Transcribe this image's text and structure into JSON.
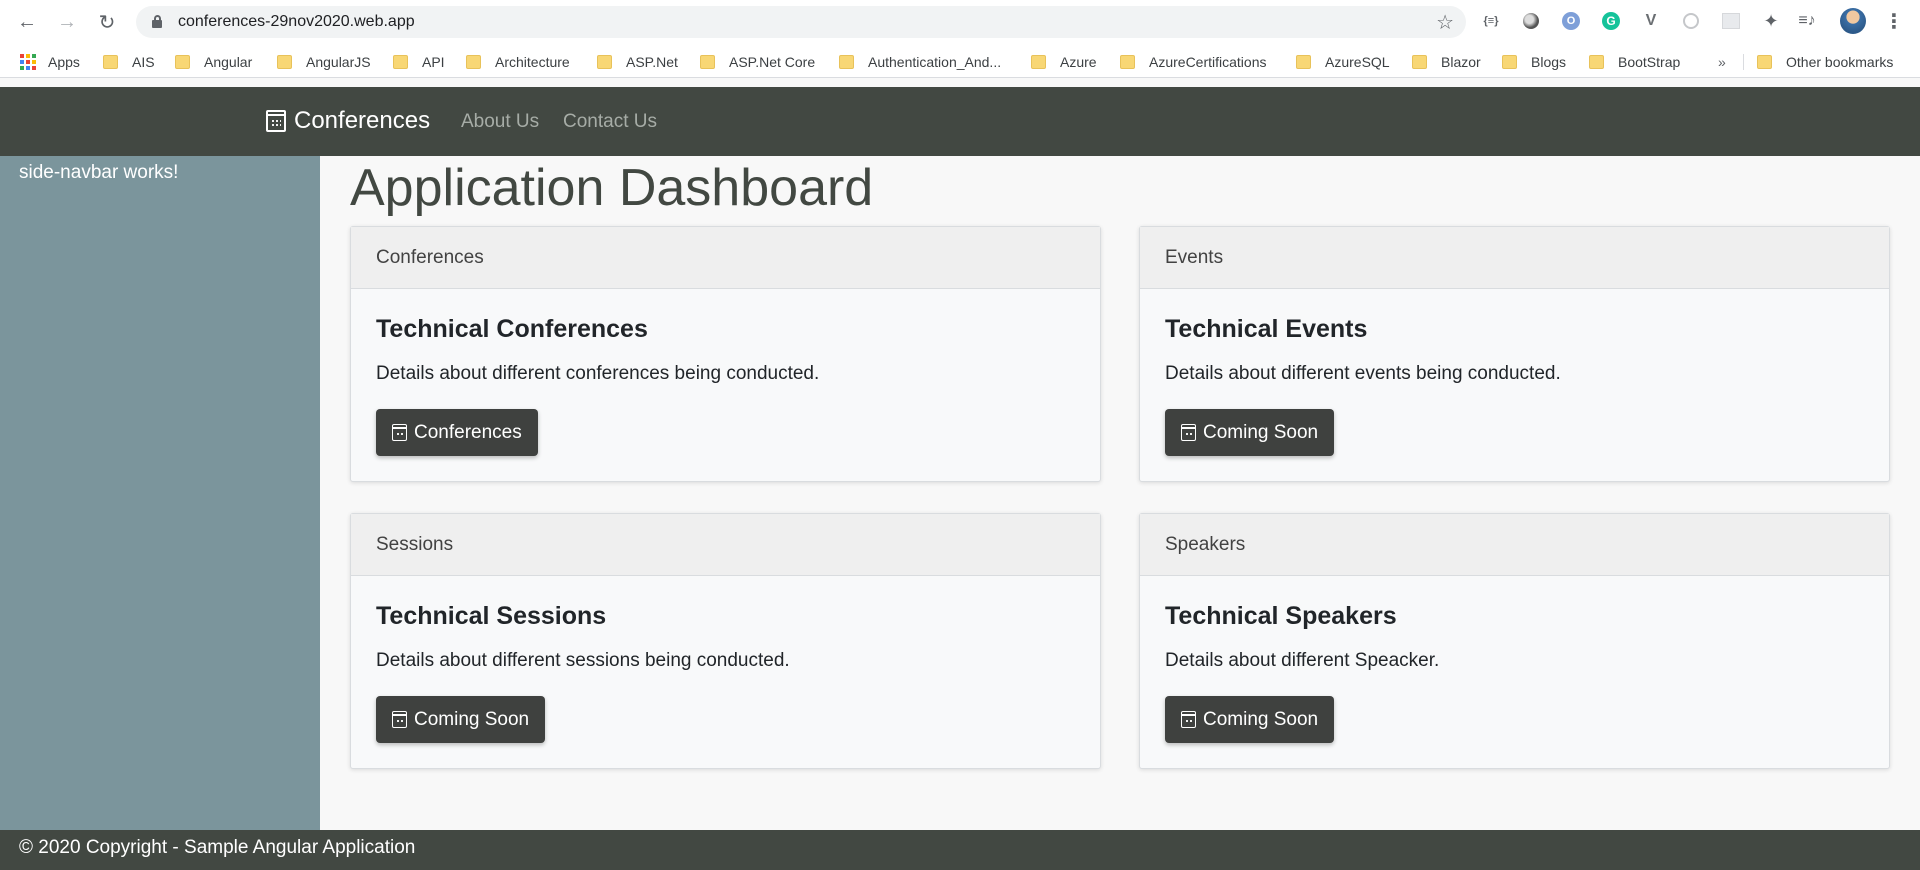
{
  "browser": {
    "url": "conferences-29nov2020.web.app",
    "extensions": [
      {
        "icon": "json-formatter-icon",
        "label": "{≡}"
      },
      {
        "icon": "circle-extension-icon"
      },
      {
        "icon": "o-extension-icon",
        "label": "O"
      },
      {
        "icon": "grammarly-icon",
        "label": "G"
      },
      {
        "icon": "vue-devtools-icon",
        "label": "V"
      },
      {
        "icon": "gray-circle-extension-icon"
      },
      {
        "icon": "gray-square-extension-icon"
      },
      {
        "icon": "puzzle-extensions-icon",
        "label": "✦"
      },
      {
        "icon": "reading-list-icon",
        "label": "≡♪"
      }
    ]
  },
  "bookmarks": {
    "apps_label": "Apps",
    "items": [
      "AIS",
      "Angular",
      "AngularJS",
      "API",
      "Architecture",
      "ASP.Net",
      "ASP.Net Core",
      "Authentication_And...",
      "Azure",
      "AzureCertifications",
      "AzureSQL",
      "Blazor",
      "Blogs",
      "BootStrap"
    ],
    "more_label": "»",
    "other_label": "Other bookmarks"
  },
  "navbar": {
    "brand": "Conferences",
    "links": [
      "About Us",
      "Contact Us"
    ]
  },
  "sidebar": {
    "text": "side-navbar works!"
  },
  "main": {
    "title": "Application Dashboard",
    "cards": [
      {
        "header": "Conferences",
        "title": "Technical Conferences",
        "text": "Details about different conferences being conducted.",
        "button": "Conferences"
      },
      {
        "header": "Events",
        "title": "Technical Events",
        "text": "Details about different events being conducted.",
        "button": "Coming Soon"
      },
      {
        "header": "Sessions",
        "title": "Technical Sessions",
        "text": "Details about different sessions being conducted.",
        "button": "Coming Soon"
      },
      {
        "header": "Speakers",
        "title": "Technical Speakers",
        "text": "Details about different Speacker.",
        "button": "Coming Soon"
      }
    ]
  },
  "footer": {
    "text": "© 2020 Copyright - Sample Angular Application"
  },
  "colors": {
    "navbar": "#424848",
    "sidebar": "#7b959c",
    "button": "#3f413f",
    "page_bg": "#f8f8f8"
  }
}
